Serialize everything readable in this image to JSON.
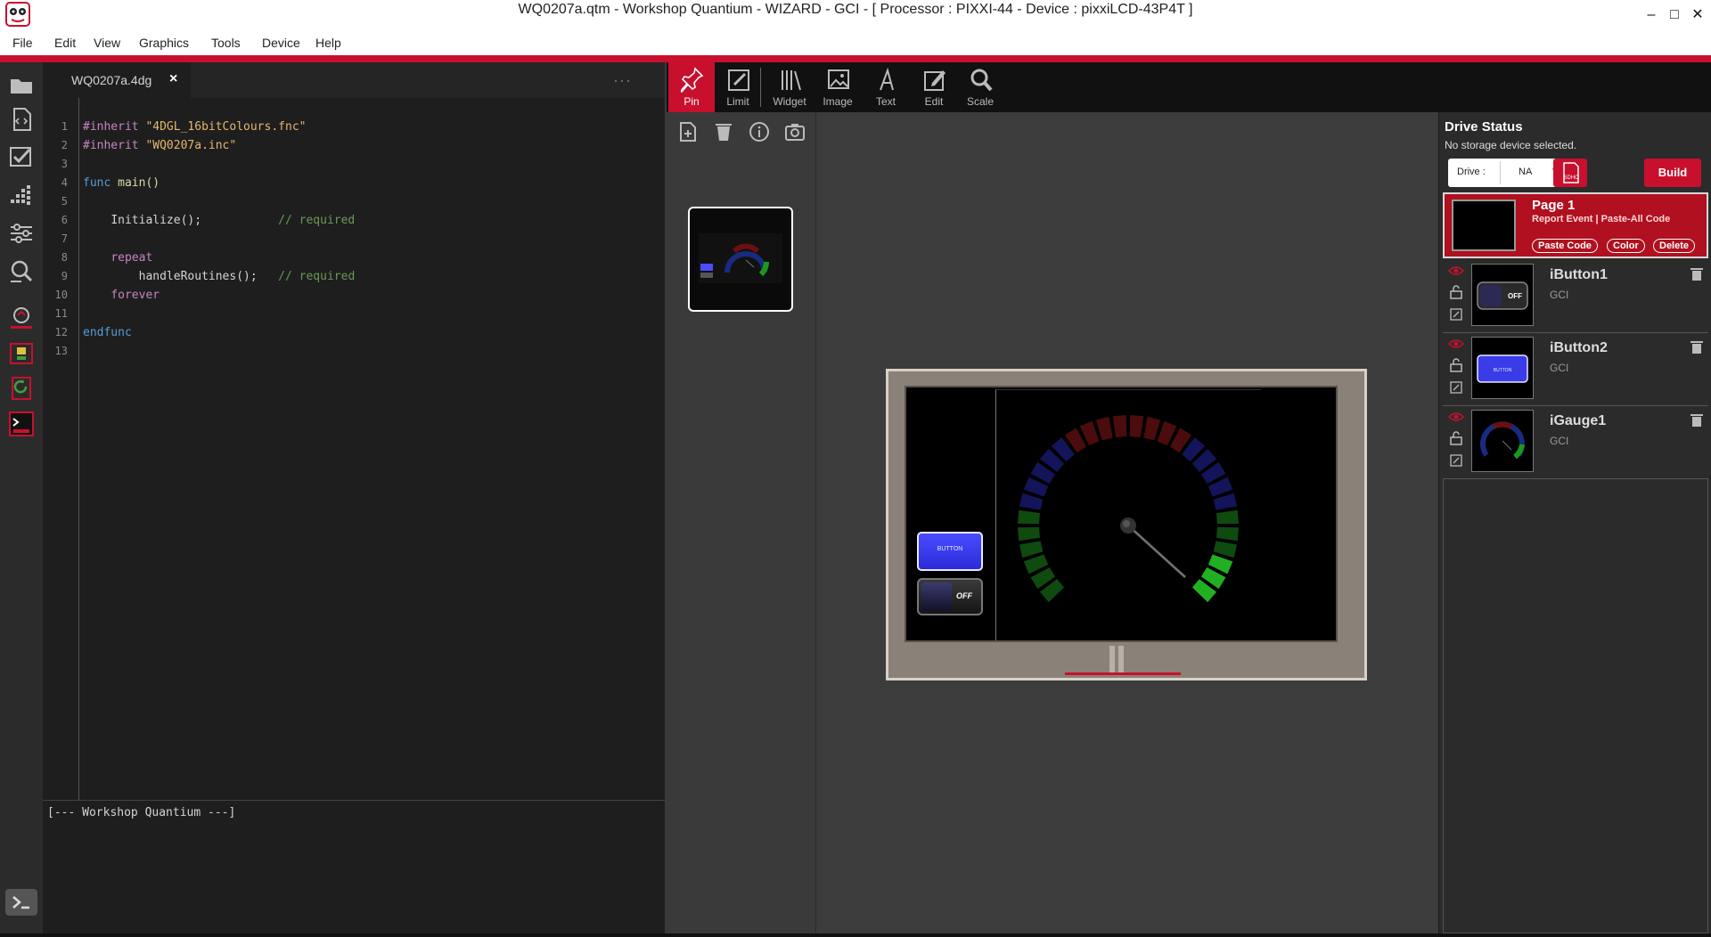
{
  "window": {
    "title": "WQ0207a.qtm - Workshop Quantium - WIZARD - GCI - [ Processor : PIXXI-44 - Device : pixxiLCD-43P4T ]",
    "minimize_glyph": "–",
    "maximize_glyph": "□",
    "close_glyph": "✕"
  },
  "menu": [
    "File",
    "Edit",
    "View",
    "Graphics",
    "Tools",
    "Device",
    "Help"
  ],
  "activity_icons": [
    "folder-icon",
    "code-file-icon",
    "checkbox-icon",
    "grid-icon",
    "sliders-icon",
    "magnifier-icon",
    "pixxi-logo-icon",
    "upload-device-icon",
    "refresh-icon",
    "rtk-terminal-icon"
  ],
  "editor": {
    "tab_label": "WQ0207a.4dg",
    "tab_close": "×",
    "more_glyph": "···",
    "line_numbers": [
      "1",
      "2",
      "3",
      "4",
      "5",
      "6",
      "7",
      "8",
      "9",
      "10",
      "11",
      "12",
      "13"
    ],
    "lines": {
      "l1_dir": "#inherit",
      "l1_str": "\"4DGL_16bitColours.fnc\"",
      "l2_dir": "#inherit",
      "l2_str": "\"WQ0207a.inc\"",
      "l4_kw": "func",
      "l4_name": "main()",
      "l6_call": "Initialize();",
      "l6_comment": "// required",
      "l8_kw": "repeat",
      "l9_call": "handleRoutines();",
      "l9_comment": "// required",
      "l10_kw": "forever",
      "l12_kw": "endfunc"
    },
    "console_text": "[--- Workshop Quantium ---]"
  },
  "designer_tools": [
    {
      "label": "Pin",
      "active": true
    },
    {
      "label": "Limit",
      "active": false
    },
    {
      "label": "Widget",
      "active": false
    },
    {
      "label": "Image",
      "active": false
    },
    {
      "label": "Text",
      "active": false
    },
    {
      "label": "Edit",
      "active": false
    },
    {
      "label": "Scale",
      "active": false
    }
  ],
  "page_tools": [
    "add-page-icon",
    "delete-page-icon",
    "info-icon",
    "camera-icon"
  ],
  "canvas": {
    "button_label": "BUTTON",
    "switch_label": "OFF"
  },
  "drive_status": {
    "title": "Drive Status",
    "subtitle": "No storage device selected.",
    "drive_label": "Drive :",
    "drive_value": "NA",
    "drive_arrow": "▼",
    "sd_label": "SDHC",
    "build_label": "Build"
  },
  "page_card": {
    "title": "Page 1",
    "links": "Report Event | Paste-All Code",
    "buttons": [
      "Paste Code",
      "Color",
      "Delete"
    ]
  },
  "widgets": [
    {
      "name": "iButton1",
      "type": "GCI"
    },
    {
      "name": "iButton2",
      "type": "GCI"
    },
    {
      "name": "iGauge1",
      "type": "GCI"
    }
  ],
  "colors": {
    "accent": "#c8102e",
    "editor_bg": "#1e1e1e",
    "panel_bg": "#2b2b2b"
  }
}
